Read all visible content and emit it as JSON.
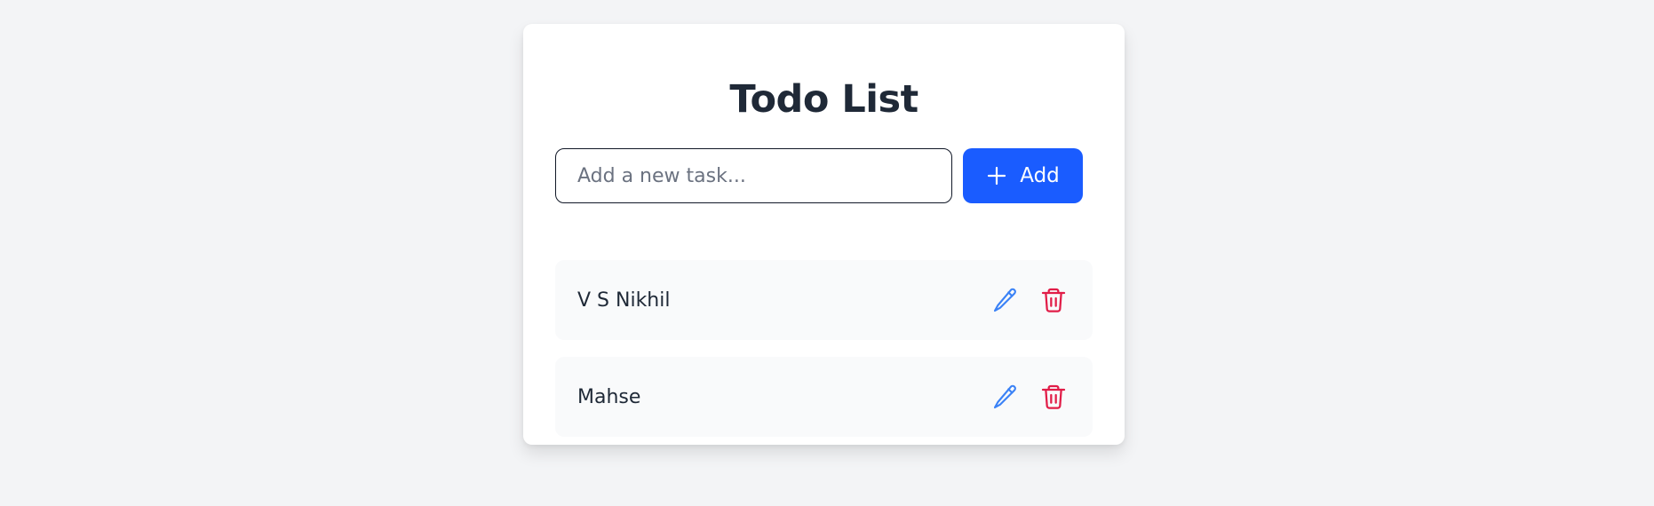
{
  "app": {
    "title": "Todo List"
  },
  "new_task": {
    "placeholder": "Add a new task...",
    "value": "",
    "add_label": "Add"
  },
  "todos": [
    {
      "text": "V S Nikhil"
    },
    {
      "text": "Mahse"
    }
  ],
  "colors": {
    "page_background": "#f3f4f6",
    "card_background": "#ffffff",
    "accent": "#1a5cff",
    "edit_icon": "#3b82f6",
    "delete_icon": "#e11d48",
    "item_background": "#f9fafb",
    "text": "#1f2937"
  },
  "icons": {
    "add": "plus-icon",
    "edit": "pencil-icon",
    "delete": "trash-icon"
  }
}
